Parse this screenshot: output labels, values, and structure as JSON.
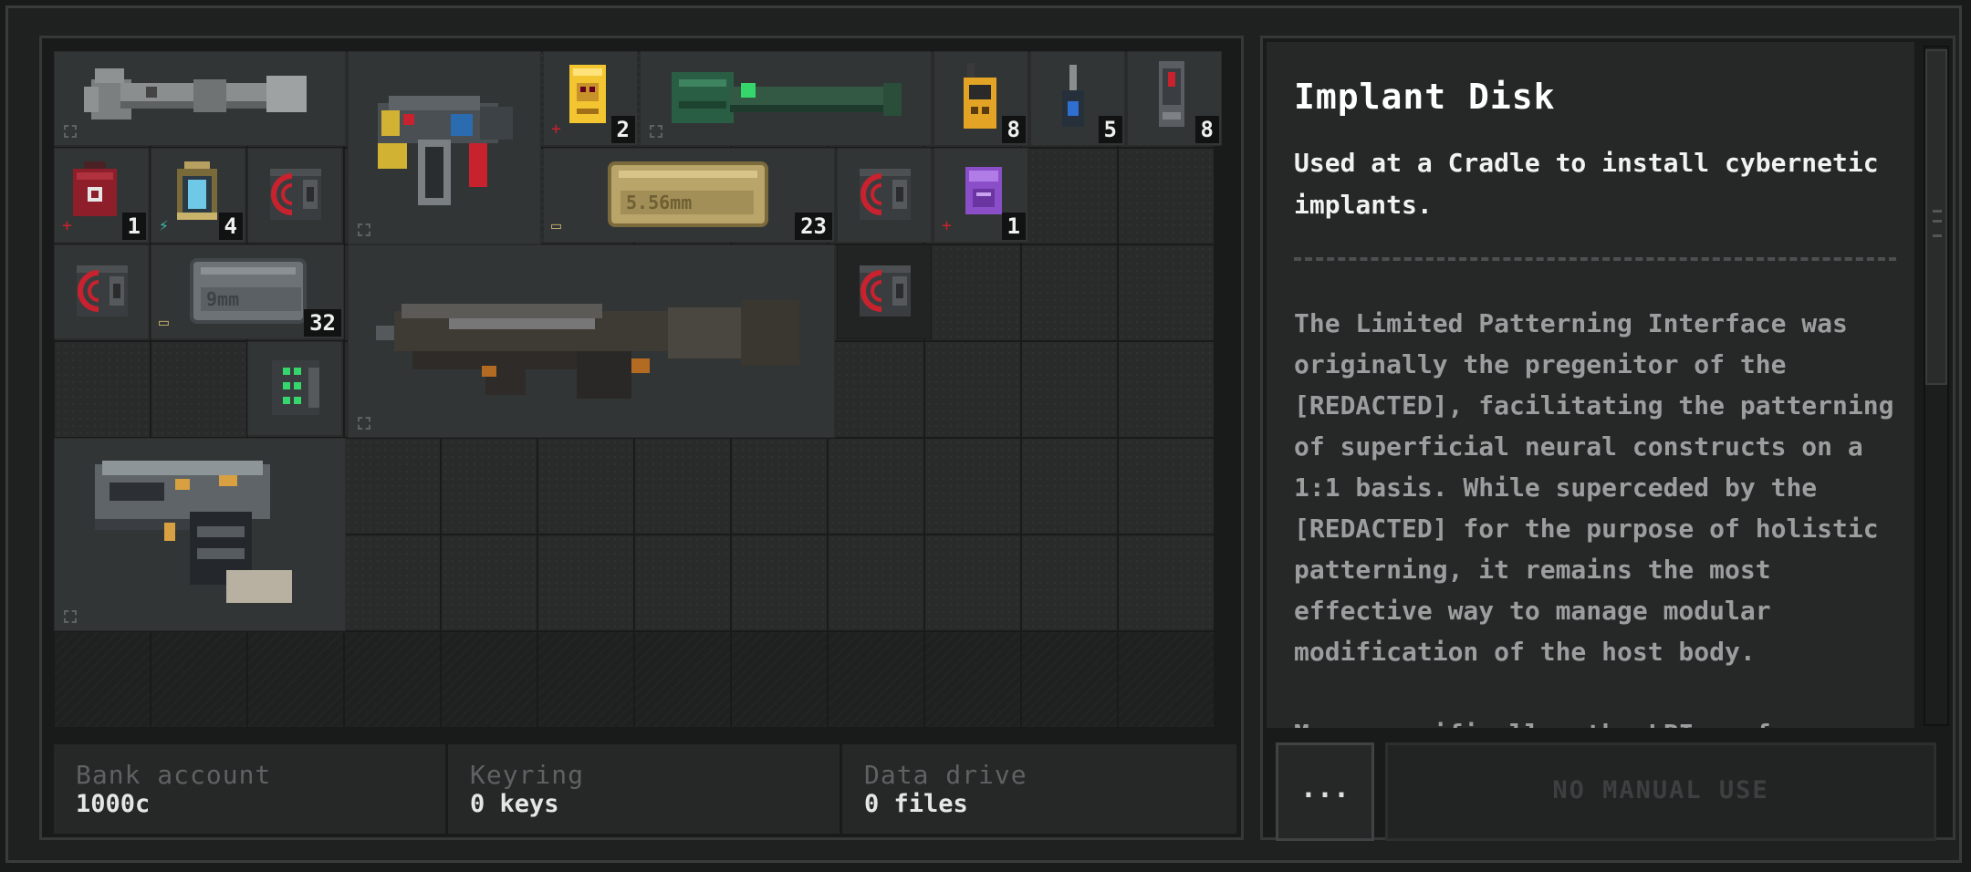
{
  "inventory": {
    "items": [
      {
        "name": "wrench",
        "qty": ""
      },
      {
        "name": "plasma-pistol",
        "qty": ""
      },
      {
        "name": "yellow-card",
        "qty": "2"
      },
      {
        "name": "green-flashlight",
        "qty": ""
      },
      {
        "name": "walkie-talkie",
        "qty": "8"
      },
      {
        "name": "blue-stick",
        "qty": "5"
      },
      {
        "name": "canister",
        "qty": "8"
      },
      {
        "name": "medkit",
        "qty": "1"
      },
      {
        "name": "battery-cell",
        "qty": "4"
      },
      {
        "name": "implant-disk-1",
        "qty": ""
      },
      {
        "name": "ammo-556",
        "qty": "23",
        "label": "5.56mm"
      },
      {
        "name": "implant-disk-2",
        "qty": ""
      },
      {
        "name": "purple-chip",
        "qty": "1"
      },
      {
        "name": "implant-disk-3",
        "qty": ""
      },
      {
        "name": "ammo-9mm",
        "qty": "32",
        "label": "9mm"
      },
      {
        "name": "assault-rifle",
        "qty": ""
      },
      {
        "name": "implant-disk-selected",
        "qty": ""
      },
      {
        "name": "green-module",
        "qty": ""
      },
      {
        "name": "silver-pistol",
        "qty": ""
      }
    ]
  },
  "footer": {
    "bank_label": "Bank account",
    "bank_value": "1000c",
    "keyring_label": "Keyring",
    "keyring_value": "0 keys",
    "data_label": "Data drive",
    "data_value": "0 files"
  },
  "info": {
    "title": "Implant Disk",
    "short_desc": "Used at a Cradle to install cybernetic implants.",
    "long_desc": "The Limited Patterning Interface was originally the pregenitor of the [REDACTED], facilitating the patterning of superficial neural constructs on a 1:1 basis. While superceded by the [REDACTED] for the purpose of holistic patterning, it remains the most effective way to manage modular modification of the host body.",
    "long_desc_more": "More specifically, the LPI performs a",
    "more_button": "...",
    "use_button": "NO MANUAL USE"
  },
  "colors": {
    "accent_red": "#c8222e",
    "ammo_tan": "#b9a46a",
    "panel_bg": "#262828"
  }
}
